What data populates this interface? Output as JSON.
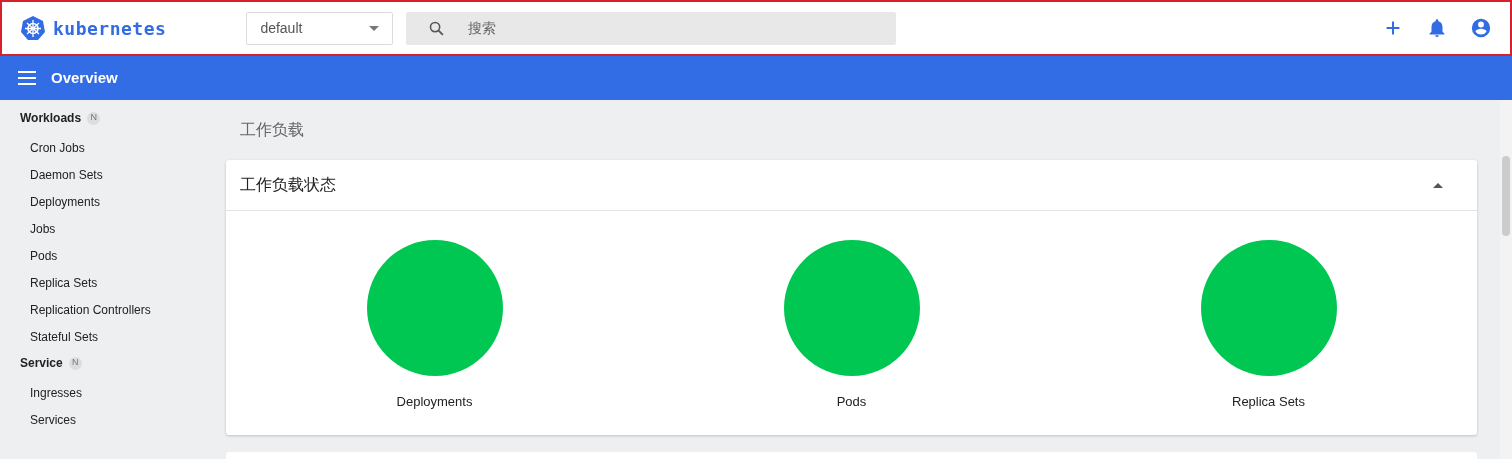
{
  "header": {
    "logo_text": "kubernetes",
    "namespace": "default",
    "search": {
      "placeholder": "搜索"
    }
  },
  "toolbar": {
    "title": "Overview"
  },
  "sidebar": {
    "sections": [
      {
        "title": "Workloads",
        "badge": "N",
        "items": [
          "Cron Jobs",
          "Daemon Sets",
          "Deployments",
          "Jobs",
          "Pods",
          "Replica Sets",
          "Replication Controllers",
          "Stateful Sets"
        ]
      },
      {
        "title": "Service",
        "badge": "N",
        "items": [
          "Ingresses",
          "Services"
        ]
      }
    ]
  },
  "page": {
    "title": "工作负载",
    "card": {
      "title": "工作负载状态",
      "expanded": true,
      "charts": [
        {
          "label": "Deployments"
        },
        {
          "label": "Pods"
        },
        {
          "label": "Replica Sets"
        }
      ]
    }
  }
}
